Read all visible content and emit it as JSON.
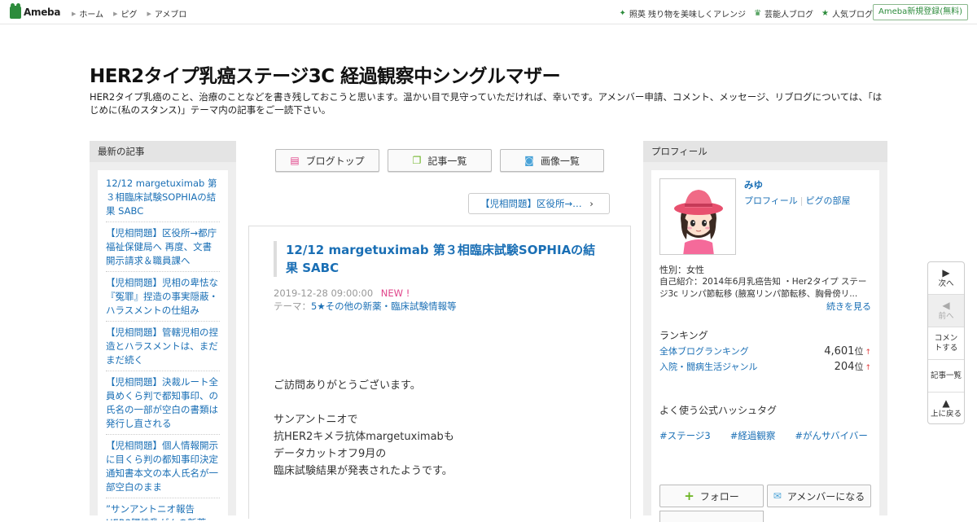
{
  "topbar": {
    "logo_text": "Ameba",
    "nav": [
      "ホーム",
      "ピグ",
      "アメブロ"
    ],
    "right_links": [
      {
        "icon": "sparkle-icon",
        "label": "照英 残り物を美味しくアレンジ"
      },
      {
        "icon": "crown-icon",
        "label": "芸能人ブログ"
      },
      {
        "icon": "star-icon",
        "label": "人気ブログ"
      }
    ],
    "register_label": "Ameba新規登録(無料)"
  },
  "blog": {
    "title": "HER2タイプ乳癌ステージ3C 経過観察中シングルマザー",
    "description": "HER2タイプ乳癌のこと、治療のことなどを書き残しておこうと思います。温かい目で見守っていただければ、幸いです。アメンバー申請、コメント、メッセージ、リブログについては、「はじめに(私のスタンス)」テーマ内の記事をご一読下さい。"
  },
  "left_sidebar": {
    "heading": "最新の記事",
    "items": [
      "12/12 margetuximab 第３相臨床試験SOPHIAの結果 SABC",
      "【児相問題】区役所→都庁 福祉保健局へ 再度、文書開示請求＆職員課へ",
      "【児相問題】児相の卑怯な『冤罪』捏造の事実隠蔽・ハラスメントの仕組み",
      "【児相問題】管轄児相の捏造とハラスメントは、まだまだ続く",
      "【児相問題】決裁ルート全員めくら判で都知事印、の氏名の一部が空白の書類は発行し直される",
      "【児相問題】個人情報開示に目くら判の都知事印決定通知書本文の本人氏名が一部空白のまま",
      "”サンアントニオ報告 HER2陽性乳がんの新薬"
    ]
  },
  "tabs": [
    {
      "icon": "document-icon",
      "label": "ブログトップ"
    },
    {
      "icon": "copy-icon",
      "label": "記事一覧"
    },
    {
      "icon": "camera-icon",
      "label": "画像一覧"
    }
  ],
  "prev_entry_label": "【児相問題】区役所→…",
  "entry": {
    "title": "12/12 margetuximab 第３相臨床試験SOPHIAの結果 SABC",
    "date": "2019-12-28 09:00:00",
    "new_badge": "NEW !",
    "theme_prefix": "テーマ：",
    "theme_link": "5★その他の新薬・臨床試験情報等",
    "body": [
      "ご訪問ありがとうございます。",
      "サンアントニオで",
      "抗HER2キメラ抗体margetuximabも",
      "データカットオフ9月の",
      "臨床試験結果が発表されたようです。"
    ]
  },
  "profile": {
    "heading": "プロフィール",
    "name": "みゆ",
    "link_profile": "プロフィール",
    "link_pig": "ピグの部屋",
    "gender": "性別：女性",
    "intro": "自己紹介：2014年6月乳癌告知 ・Her2タイプ ステージ3c リンパ節転移 (腋窩リンパ節転移、胸骨傍リ...",
    "more_label": "続きを見る",
    "ranking_heading": "ランキング",
    "rankings": [
      {
        "name": "全体ブログランキング",
        "value": "4,601",
        "unit": "位",
        "trend": "↑"
      },
      {
        "name": "入院・闘病生活ジャンル",
        "value": "204",
        "unit": "位",
        "trend": "↑"
      }
    ],
    "hashtag_heading": "よく使う公式ハッシュタグ",
    "hashtags": [
      "#ステージ3",
      "#経過観察",
      "#がんサバイバー"
    ],
    "follow_label": "フォロー",
    "amember_label": "アメンバーになる"
  },
  "floatnav": [
    {
      "icon": "next-icon",
      "label": "次へ",
      "enabled": true
    },
    {
      "icon": "prev-icon",
      "label": "前へ",
      "enabled": false
    },
    {
      "icon": "",
      "label": "コメントする",
      "enabled": true
    },
    {
      "icon": "",
      "label": "記事一覧",
      "enabled": true
    },
    {
      "icon": "up-icon",
      "label": "上に戻る",
      "enabled": true
    }
  ],
  "colors": {
    "brand_green": "#2d8c3c",
    "link_blue": "#1a6fb5",
    "new_pink": "#e0448a"
  }
}
